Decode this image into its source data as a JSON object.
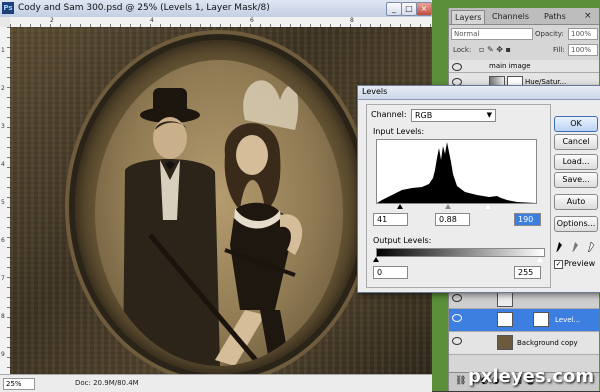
{
  "document": {
    "title": "Cody and Sam 300.psd @ 25% (Levels 1, Layer Mask/8)",
    "app_badge": "Ps",
    "minimize": "_",
    "maximize": "□",
    "close": "×",
    "ruler_ticks": [
      "2",
      "4",
      "6",
      "8"
    ],
    "left_ruler_ticks": [
      "1",
      "2",
      "3",
      "4",
      "5",
      "6",
      "7",
      "8",
      "9"
    ],
    "zoom": "25%",
    "doc_size": "Doc: 20.9M/80.4M"
  },
  "layers_panel": {
    "tabs": [
      "Layers",
      "Channels",
      "Paths"
    ],
    "blend_mode": "Normal",
    "opacity_label": "Opacity:",
    "opacity_value": "100%",
    "lock_label": "Lock:",
    "fill_label": "Fill:",
    "fill_value": "100%",
    "layers": [
      {
        "name": "main image",
        "selected": false
      },
      {
        "name": "Hue/Satur...",
        "selected": false
      },
      {
        "name": "Level...",
        "selected": true
      },
      {
        "name": "Background copy",
        "selected": false
      }
    ]
  },
  "levels_dialog": {
    "title": "Levels",
    "channel_label": "Channel:",
    "channel_value": "RGB",
    "input_levels_label": "Input Levels:",
    "input_black": "41",
    "input_gamma": "0.88",
    "input_white": "190",
    "output_levels_label": "Output Levels:",
    "output_black": "0",
    "output_white": "255",
    "buttons": {
      "ok": "OK",
      "cancel": "Cancel",
      "load": "Load...",
      "save": "Save...",
      "auto": "Auto",
      "options": "Options..."
    },
    "preview_label": "Preview",
    "preview_checked": true
  },
  "watermark": "pxleyes.com",
  "colors": {
    "selection_blue": "#3d7fe0",
    "panel_gray": "#d6d6d6",
    "sepia_dark": "#3e3322",
    "sepia_light": "#b59c6f"
  }
}
